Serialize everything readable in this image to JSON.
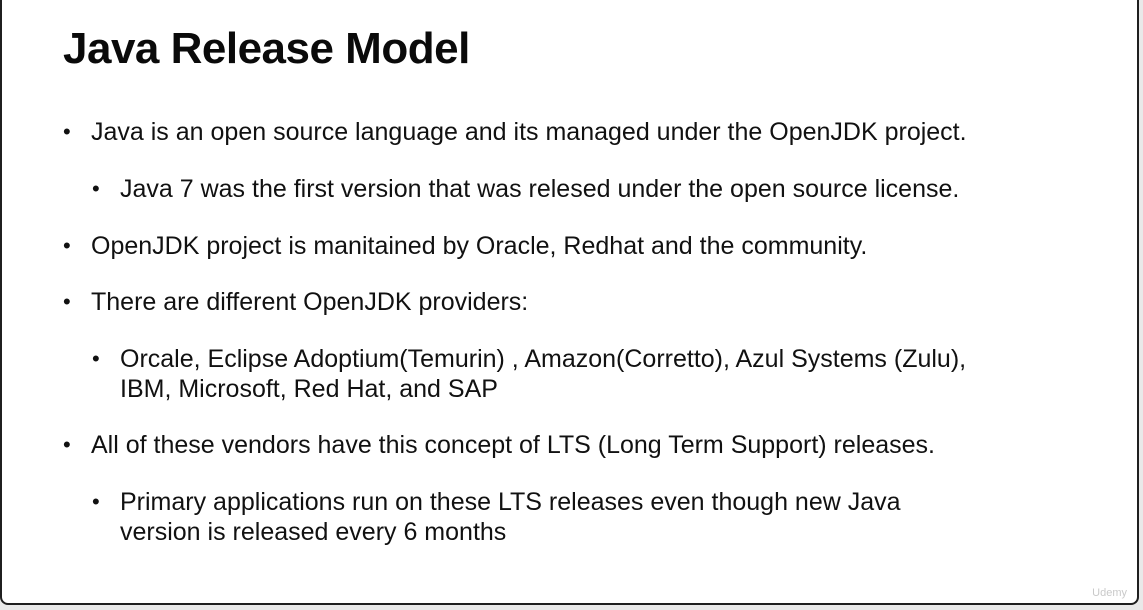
{
  "slide": {
    "title": "Java Release Model",
    "bullets": [
      {
        "level": 1,
        "text": "Java is an open source language and its managed under the OpenJDK project."
      },
      {
        "level": 2,
        "text": "Java 7 was the first version that was relesed under the open source license."
      },
      {
        "level": 1,
        "text": "OpenJDK project is manitained by Oracle, Redhat and the community."
      },
      {
        "level": 1,
        "text": "There are different OpenJDK providers:"
      },
      {
        "level": 2,
        "lines": [
          "Orcale, Eclipse Adoptium(Temurin) , Amazon(Corretto), Azul Systems (Zulu),",
          "IBM, Microsoft, Red Hat, and SAP"
        ]
      },
      {
        "level": 1,
        "text": "All of these vendors have this concept of LTS (Long Term Support) releases."
      },
      {
        "level": 2,
        "lines": [
          "Primary applications run on these LTS releases even though new Java",
          "version is released every 6 months"
        ]
      }
    ],
    "bullet_symbol": "•",
    "watermark": "Udemy"
  }
}
